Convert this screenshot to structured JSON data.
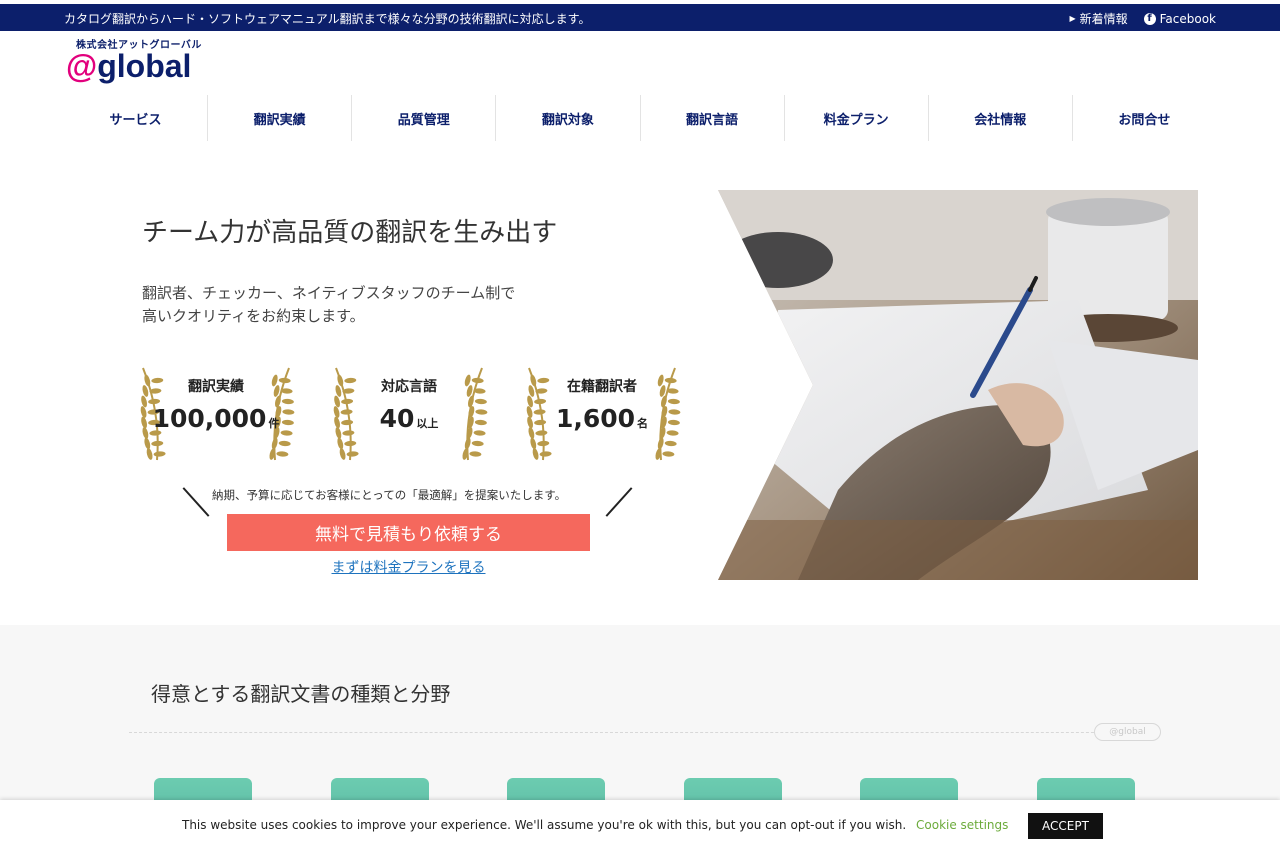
{
  "topbar": {
    "tagline": "カタログ翻訳からハード・ソフトウェアマニュアル翻訳まで様々な分野の技術翻訳に対応します。",
    "news_label": "新着情報",
    "facebook_label": "Facebook"
  },
  "logo": {
    "company": "株式会社アットグローバル",
    "at": "@",
    "word": "global"
  },
  "nav": {
    "items": [
      "サービス",
      "翻訳実績",
      "品質管理",
      "翻訳対象",
      "翻訳言語",
      "料金プラン",
      "会社情報",
      "お問合せ"
    ]
  },
  "hero": {
    "title": "チーム力が高品質の翻訳を生み出す",
    "desc_line1": "翻訳者、チェッカー、ネイティブスタッフのチーム制で",
    "desc_line2": "高いクオリティをお約束します。",
    "stats": [
      {
        "label": "翻訳実績",
        "value": "100,000",
        "unit": "件"
      },
      {
        "label": "対応言語",
        "value": "40",
        "unit": "以上"
      },
      {
        "label": "在籍翻訳者",
        "value": "1,600",
        "unit": "名"
      }
    ],
    "cta_note": "納期、予算に応じてお客様にとっての「最適解」を提案いたします。",
    "cta_button": "無料で見積もり依頼する",
    "cta_link": "まずは料金プランを見る"
  },
  "section2": {
    "heading": "得意とする翻訳文書の種類と分野",
    "pill": "@global"
  },
  "cookie": {
    "message": "This website uses cookies to improve your experience. We'll assume you're ok with this, but you can opt-out if you wish.",
    "settings": "Cookie settings",
    "accept": "ACCEPT"
  },
  "colors": {
    "navy": "#0c1f6b",
    "magenta": "#e2007d",
    "cta": "#f5685d",
    "link": "#1e73be",
    "laurel": "#b99a4a",
    "teal": "#6cccb0",
    "cookie_settings": "#6cab3c"
  }
}
